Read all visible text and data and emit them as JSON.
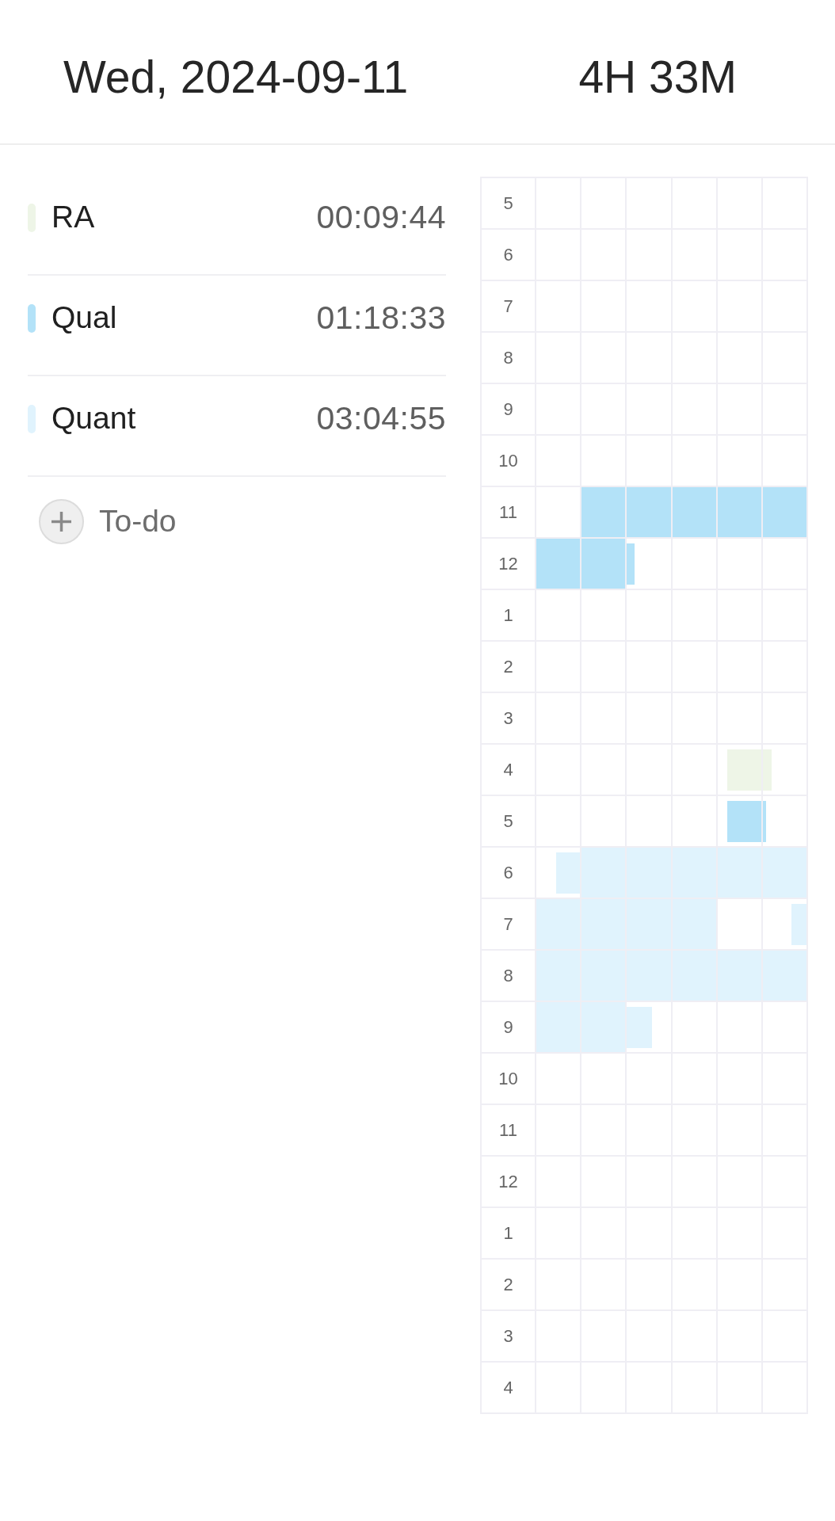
{
  "header": {
    "date": "Wed, 2024-09-11",
    "total": "4H 33M"
  },
  "tasks": [
    {
      "name": "RA",
      "duration": "00:09:44",
      "color": "#eef5e7"
    },
    {
      "name": "Qual",
      "duration": "01:18:33",
      "color": "#b3e2f8"
    },
    {
      "name": "Quant",
      "duration": "03:04:55",
      "color": "#e0f3fd"
    }
  ],
  "add_button": {
    "label": "To-do"
  },
  "grid": {
    "rows": [
      {
        "hour": "5",
        "cells": [
          {
            "filled": false
          },
          {
            "filled": false
          },
          {
            "filled": false
          },
          {
            "filled": false
          },
          {
            "filled": false
          },
          {
            "filled": false
          }
        ]
      },
      {
        "hour": "6",
        "cells": [
          {
            "filled": false
          },
          {
            "filled": false
          },
          {
            "filled": false
          },
          {
            "filled": false
          },
          {
            "filled": false
          },
          {
            "filled": false
          }
        ]
      },
      {
        "hour": "7",
        "cells": [
          {
            "filled": false
          },
          {
            "filled": false
          },
          {
            "filled": false
          },
          {
            "filled": false
          },
          {
            "filled": false
          },
          {
            "filled": false
          }
        ]
      },
      {
        "hour": "8",
        "cells": [
          {
            "filled": false
          },
          {
            "filled": false
          },
          {
            "filled": false
          },
          {
            "filled": false
          },
          {
            "filled": false
          },
          {
            "filled": false
          }
        ]
      },
      {
        "hour": "9",
        "cells": [
          {
            "filled": false
          },
          {
            "filled": false
          },
          {
            "filled": false
          },
          {
            "filled": false
          },
          {
            "filled": false
          },
          {
            "filled": false
          }
        ]
      },
      {
        "hour": "10",
        "cells": [
          {
            "filled": false
          },
          {
            "filled": false
          },
          {
            "filled": false
          },
          {
            "filled": false
          },
          {
            "filled": false
          },
          {
            "filled": false
          }
        ]
      },
      {
        "hour": "11",
        "cells": [
          {
            "filled": false
          },
          {
            "filled": true,
            "color": "#b3e2f8"
          },
          {
            "filled": true,
            "color": "#b3e2f8"
          },
          {
            "filled": true,
            "color": "#b3e2f8"
          },
          {
            "filled": true,
            "color": "#b3e2f8"
          },
          {
            "filled": true,
            "color": "#b3e2f8"
          }
        ]
      },
      {
        "hour": "12",
        "cells": [
          {
            "filled": true,
            "color": "#b3e2f8"
          },
          {
            "filled": true,
            "color": "#b3e2f8"
          },
          {
            "filled": true,
            "color": "#b3e2f8",
            "level": 0.17,
            "right_aligned": false
          },
          {
            "filled": false
          },
          {
            "filled": false
          },
          {
            "filled": false
          }
        ]
      },
      {
        "hour": "1",
        "cells": [
          {
            "filled": false
          },
          {
            "filled": false
          },
          {
            "filled": false
          },
          {
            "filled": false
          },
          {
            "filled": false
          },
          {
            "filled": false
          }
        ]
      },
      {
        "hour": "2",
        "cells": [
          {
            "filled": false
          },
          {
            "filled": false
          },
          {
            "filled": false
          },
          {
            "filled": false
          },
          {
            "filled": false
          },
          {
            "filled": false
          }
        ]
      },
      {
        "hour": "3",
        "cells": [
          {
            "filled": false
          },
          {
            "filled": false
          },
          {
            "filled": false
          },
          {
            "filled": false
          },
          {
            "filled": false
          },
          {
            "filled": false
          }
        ]
      },
      {
        "hour": "4",
        "cells": [
          {
            "filled": false
          },
          {
            "filled": false
          },
          {
            "filled": false
          },
          {
            "filled": false
          },
          {
            "filled": true,
            "color": "#eef5e7",
            "level": 0.78,
            "right_aligned": true
          },
          {
            "filled": true,
            "color": "#eef5e7",
            "level": 0.2,
            "right_aligned": false
          }
        ]
      },
      {
        "hour": "5",
        "cells": [
          {
            "filled": false
          },
          {
            "filled": false
          },
          {
            "filled": false
          },
          {
            "filled": false
          },
          {
            "filled": true,
            "color": "#b3e2f8",
            "level": 0.78,
            "right_aligned": true
          },
          {
            "filled": true,
            "color": "#b3e2f8",
            "level": 0.07,
            "right_aligned": false
          }
        ]
      },
      {
        "hour": "6",
        "cells": [
          {
            "filled": true,
            "color": "#e0f3fd",
            "level": 0.55,
            "right_aligned": true
          },
          {
            "filled": true,
            "color": "#e0f3fd"
          },
          {
            "filled": true,
            "color": "#e0f3fd"
          },
          {
            "filled": true,
            "color": "#e0f3fd"
          },
          {
            "filled": true,
            "color": "#e0f3fd"
          },
          {
            "filled": true,
            "color": "#e0f3fd"
          }
        ]
      },
      {
        "hour": "7",
        "cells": [
          {
            "filled": true,
            "color": "#e0f3fd"
          },
          {
            "filled": true,
            "color": "#e0f3fd"
          },
          {
            "filled": true,
            "color": "#e0f3fd"
          },
          {
            "filled": true,
            "color": "#e0f3fd"
          },
          {
            "filled": false
          },
          {
            "filled": true,
            "color": "#e0f3fd",
            "level": 0.35,
            "right_aligned": true
          }
        ]
      },
      {
        "hour": "8",
        "cells": [
          {
            "filled": true,
            "color": "#e0f3fd"
          },
          {
            "filled": true,
            "color": "#e0f3fd"
          },
          {
            "filled": true,
            "color": "#e0f3fd"
          },
          {
            "filled": true,
            "color": "#e0f3fd"
          },
          {
            "filled": true,
            "color": "#e0f3fd"
          },
          {
            "filled": true,
            "color": "#e0f3fd"
          }
        ]
      },
      {
        "hour": "9",
        "cells": [
          {
            "filled": true,
            "color": "#e0f3fd"
          },
          {
            "filled": true,
            "color": "#e0f3fd"
          },
          {
            "filled": true,
            "color": "#e0f3fd",
            "level": 0.58,
            "right_aligned": false
          },
          {
            "filled": false
          },
          {
            "filled": false
          },
          {
            "filled": false
          }
        ]
      },
      {
        "hour": "10",
        "cells": [
          {
            "filled": false
          },
          {
            "filled": false
          },
          {
            "filled": false
          },
          {
            "filled": false
          },
          {
            "filled": false
          },
          {
            "filled": false
          }
        ]
      },
      {
        "hour": "11",
        "cells": [
          {
            "filled": false
          },
          {
            "filled": false
          },
          {
            "filled": false
          },
          {
            "filled": false
          },
          {
            "filled": false
          },
          {
            "filled": false
          }
        ]
      },
      {
        "hour": "12",
        "cells": [
          {
            "filled": false
          },
          {
            "filled": false
          },
          {
            "filled": false
          },
          {
            "filled": false
          },
          {
            "filled": false
          },
          {
            "filled": false
          }
        ]
      },
      {
        "hour": "1",
        "cells": [
          {
            "filled": false
          },
          {
            "filled": false
          },
          {
            "filled": false
          },
          {
            "filled": false
          },
          {
            "filled": false
          },
          {
            "filled": false
          }
        ]
      },
      {
        "hour": "2",
        "cells": [
          {
            "filled": false
          },
          {
            "filled": false
          },
          {
            "filled": false
          },
          {
            "filled": false
          },
          {
            "filled": false
          },
          {
            "filled": false
          }
        ]
      },
      {
        "hour": "3",
        "cells": [
          {
            "filled": false
          },
          {
            "filled": false
          },
          {
            "filled": false
          },
          {
            "filled": false
          },
          {
            "filled": false
          },
          {
            "filled": false
          }
        ]
      },
      {
        "hour": "4",
        "cells": [
          {
            "filled": false
          },
          {
            "filled": false
          },
          {
            "filled": false
          },
          {
            "filled": false
          },
          {
            "filled": false
          },
          {
            "filled": false
          }
        ]
      }
    ]
  }
}
